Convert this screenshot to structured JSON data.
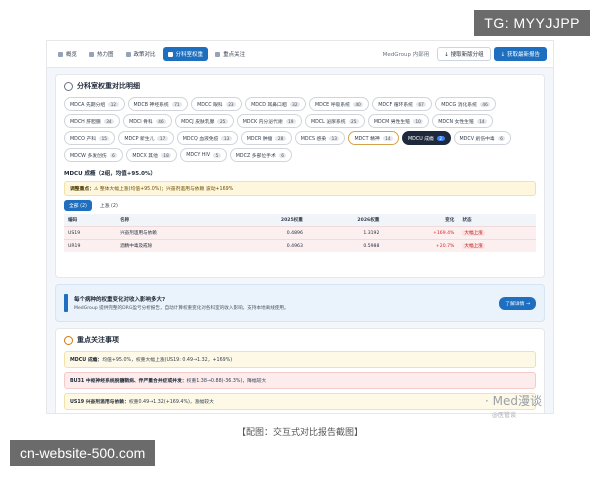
{
  "overlay": {
    "tg_label": "TG: MYYJJPP",
    "site_label": "cn-website-500.com",
    "caption": "【配图：交互式对比报告截图】",
    "watermark": "· Med漫谈",
    "watermark_sub": "@医管谈"
  },
  "nav": {
    "tabs": [
      {
        "label": "概览"
      },
      {
        "label": "热力图"
      },
      {
        "label": "政策对比"
      },
      {
        "label": "分科室权重"
      },
      {
        "label": "重点关注"
      }
    ],
    "active_index": 3,
    "user": "MedGroup 内部用",
    "btn_secondary": "↓ 搜取新版分组",
    "btn_primary": "↓ 获取最新报告"
  },
  "section": {
    "title": "分科室权重对比明细",
    "pills": [
      {
        "label": "MDCA 先期分组",
        "count": "12"
      },
      {
        "label": "MDCB 神经系统",
        "count": "71"
      },
      {
        "label": "MDCC 眼科",
        "count": "23"
      },
      {
        "label": "MDCD 耳鼻口咽",
        "count": "32"
      },
      {
        "label": "MDCE 呼吸系统",
        "count": "40"
      },
      {
        "label": "MDCF 循环系统",
        "count": "67"
      },
      {
        "label": "MDCG 消化系统",
        "count": "46"
      },
      {
        "label": "MDCH 肝胆胰",
        "count": "34"
      },
      {
        "label": "MDCI 骨科",
        "count": "46"
      },
      {
        "label": "MDCJ 皮肤乳腺",
        "count": "25"
      },
      {
        "label": "MDCK 内分泌代谢",
        "count": "19"
      },
      {
        "label": "MDCL 泌尿系统",
        "count": "25"
      },
      {
        "label": "MDCM 男性生殖",
        "count": "10"
      },
      {
        "label": "MDCN 女性生殖",
        "count": "14"
      },
      {
        "label": "MDCO 产科",
        "count": "15"
      },
      {
        "label": "MDCP 新生儿",
        "count": "17"
      },
      {
        "label": "MDCQ 血液免疫",
        "count": "13"
      },
      {
        "label": "MDCR 肿瘤",
        "count": "28"
      },
      {
        "label": "MDCS 感染",
        "count": "13"
      },
      {
        "label": "MDCT 精神",
        "count": "14"
      },
      {
        "label": "MDCU 成瘾",
        "count": "2"
      },
      {
        "label": "MDCV 創伤中毒",
        "count": "6"
      },
      {
        "label": "MDCW 多发创伤",
        "count": "6"
      },
      {
        "label": "MDCX 其他",
        "count": "18"
      },
      {
        "label": "MDCY HIV",
        "count": "5"
      },
      {
        "label": "MDCZ 多部位手术",
        "count": "6"
      }
    ],
    "outlined_index": 19,
    "active_index": 20
  },
  "detail": {
    "title": "MDCU 成瘾（2组，均值+95.0%）",
    "alert_label": "调整重点：",
    "alert_text": "⚠ 整体大幅上涨(均值+95.0%)；兴奋剂滥用与依赖 波动+169%",
    "subtabs": [
      "全部 (2)",
      "上涨 (2)"
    ],
    "columns": [
      "编码",
      "名称",
      "2025权重",
      "2026权重",
      "变化",
      "状态"
    ],
    "rows": [
      {
        "code": "US19",
        "name": "兴奋剂滥用与依赖",
        "w2025": "0.4896",
        "w2026": "1.3192",
        "change": "+169.4%",
        "status": "大幅上涨"
      },
      {
        "code": "UR19",
        "name": "酒精中毒及戒除",
        "w2025": "0.4963",
        "w2026": "0.5988",
        "change": "+20.7%",
        "status": "大幅上涨"
      }
    ]
  },
  "banner": {
    "question": "每个病种的权重变化对收入影响多大?",
    "description": "MedGroup 提供完整的DRG盈亏分析报告，自动计算权重变化对各科室的收入影响，支持本地离线使用。",
    "button": "了解详情 →"
  },
  "focus": {
    "title": "重点关注事项",
    "items": [
      {
        "bold": "MDCU 成瘾：",
        "text": "均值+95.0%，权重大幅上涨(US19: 0.49→1.32，+169%)",
        "tone": "yellow"
      },
      {
        "bold": "BU31 中枢神经系统脱髓鞘病、伴严重合并症或并发：",
        "text": "权重1.38→0.88(-36.3%)，降幅较大",
        "tone": "red"
      },
      {
        "bold": "US19 兴奋剂滥用与依赖：",
        "text": "权重0.49→1.32(+169.4%)，涨幅较大",
        "tone": "yellow"
      }
    ]
  }
}
